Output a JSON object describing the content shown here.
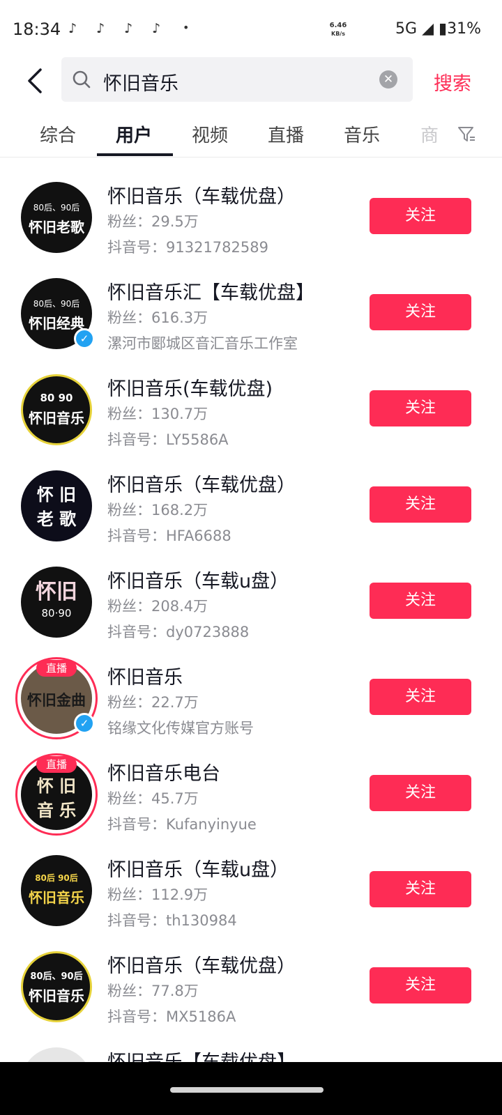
{
  "status_bar": {
    "time": "18:34",
    "app_icons": [
      "tiktok-icon",
      "tiktok-icon",
      "tiktok-icon",
      "tiktok-icon"
    ],
    "tiktok_glyph": "♪",
    "more_dot": "•",
    "speed_value": "6.46",
    "speed_unit": "KB/s",
    "right": "5G ◢ ▮31%"
  },
  "search": {
    "value": "怀旧音乐",
    "submit_label": "搜索"
  },
  "tabs": [
    {
      "label": "综合"
    },
    {
      "label": "用户"
    },
    {
      "label": "视频"
    },
    {
      "label": "直播"
    },
    {
      "label": "音乐"
    },
    {
      "label": "商"
    }
  ],
  "results": [
    {
      "name": "怀旧音乐（车载优盘）",
      "fans": "粉丝：29.5万",
      "id_line": "抖音号：91321782589",
      "follow_label": "关注",
      "avatar_top": "80后、90后",
      "avatar_main": "怀旧老歌"
    },
    {
      "name": "怀旧音乐汇【车载优盘】",
      "fans": "粉丝：616.3万",
      "id_line": "漯河市郾城区音汇音乐工作室",
      "follow_label": "关注",
      "avatar_top": "80后、90后",
      "avatar_main": "怀旧经典"
    },
    {
      "name": "怀旧音乐(车载优盘)",
      "fans": "粉丝：130.7万",
      "id_line": "抖音号：LY5586A",
      "follow_label": "关注",
      "avatar_top": "80 90",
      "avatar_main": "怀旧音乐"
    },
    {
      "name": "怀旧音乐（车载优盘）",
      "fans": "粉丝：168.2万",
      "id_line": "抖音号：HFA6688",
      "follow_label": "关注",
      "avatar_top": "怀 旧",
      "avatar_main": "老 歌"
    },
    {
      "name": "怀旧音乐（车载u盘）",
      "fans": "粉丝：208.4万",
      "id_line": "抖音号：dy0723888",
      "follow_label": "关注",
      "avatar_top": "怀旧",
      "avatar_main": "80·90"
    },
    {
      "name": "怀旧音乐",
      "fans": "粉丝：22.7万",
      "id_line": "铭缘文化传媒官方账号",
      "follow_label": "关注",
      "avatar_top": "",
      "avatar_main": "怀旧金曲",
      "live_badge": "直播"
    },
    {
      "name": "怀旧音乐电台",
      "fans": "粉丝：45.7万",
      "id_line": "抖音号：Kufanyinyue",
      "follow_label": "关注",
      "avatar_top": "怀 旧",
      "avatar_main": "音 乐",
      "live_badge": "直播"
    },
    {
      "name": "怀旧音乐（车载u盘）",
      "fans": "粉丝：112.9万",
      "id_line": "抖音号：th130984",
      "follow_label": "关注",
      "avatar_top": "80后 90后",
      "avatar_main": "怀旧音乐"
    },
    {
      "name": "怀旧音乐（车载优盘）",
      "fans": "粉丝：77.8万",
      "id_line": "抖音号：MX5186A",
      "follow_label": "关注",
      "avatar_top": "80后、90后",
      "avatar_main": "怀旧音乐"
    },
    {
      "name": "怀旧音乐【车载优盘】"
    }
  ],
  "colors": {
    "accent": "#fe2c55",
    "verified": "#22a2f2"
  }
}
